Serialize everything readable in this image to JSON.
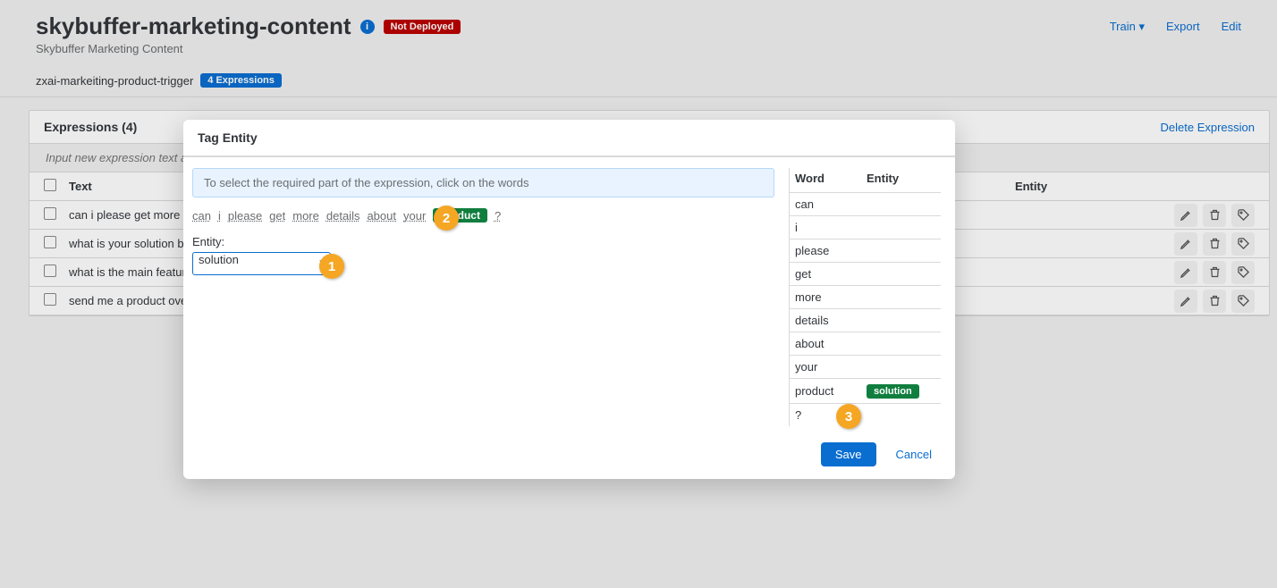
{
  "header": {
    "title": "skybuffer-marketing-content",
    "status_badge": "Not Deployed",
    "subtitle": "Skybuffer Marketing Content",
    "trigger_name": "zxai-markeiting-product-trigger",
    "trigger_badge": "4 Expressions",
    "actions": {
      "train": "Train",
      "export": "Export",
      "edit": "Edit"
    }
  },
  "panel": {
    "heading": "Expressions (4)",
    "delete_link": "Delete Expression",
    "input_placeholder": "Input new expression text and p",
    "col_text": "Text",
    "col_entity": "Entity",
    "rows": [
      {
        "text": "can i please get more details"
      },
      {
        "text": "what is your solution built wit"
      },
      {
        "text": "what is the main feature of th"
      },
      {
        "text": "send me a product overview"
      }
    ]
  },
  "modal": {
    "title": "Tag Entity",
    "info": "To select the required part of the expression, click on the words",
    "tokens": [
      "can",
      "i",
      "please",
      "get",
      "more",
      "details",
      "about",
      "your"
    ],
    "tagged_token": "product",
    "trailing_token": "?",
    "entity_label": "Entity:",
    "entity_value": "solution",
    "word_col": "Word",
    "entity_col": "Entity",
    "words": [
      {
        "w": "can",
        "e": ""
      },
      {
        "w": "i",
        "e": ""
      },
      {
        "w": "please",
        "e": ""
      },
      {
        "w": "get",
        "e": ""
      },
      {
        "w": "more",
        "e": ""
      },
      {
        "w": "details",
        "e": ""
      },
      {
        "w": "about",
        "e": ""
      },
      {
        "w": "your",
        "e": ""
      },
      {
        "w": "product",
        "e": "solution"
      },
      {
        "w": "?",
        "e": ""
      }
    ],
    "save": "Save",
    "cancel": "Cancel"
  },
  "steps": {
    "s1": "1",
    "s2": "2",
    "s3": "3"
  }
}
